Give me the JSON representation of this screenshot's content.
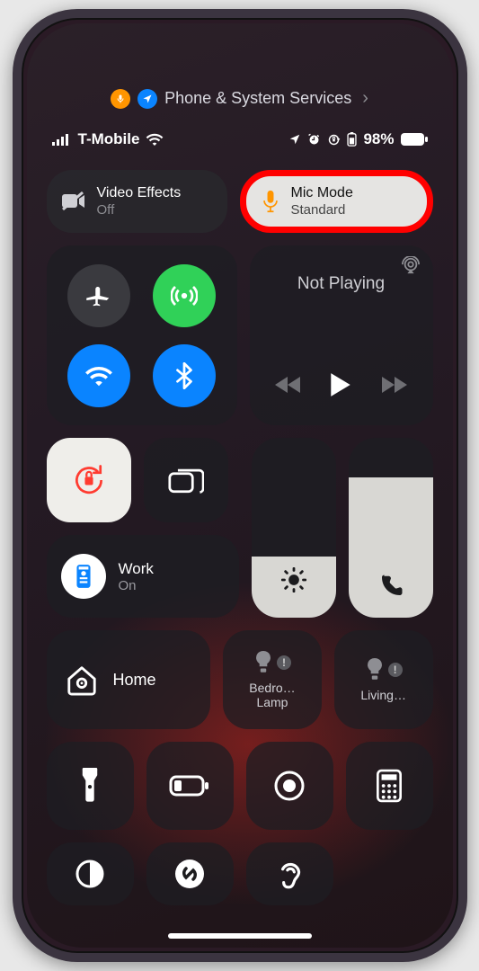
{
  "privacy_banner": {
    "label": "Phone & System Services"
  },
  "status_bar": {
    "carrier": "T-Mobile",
    "battery_pct": "98%"
  },
  "mode_pills": {
    "video": {
      "title": "Video Effects",
      "subtitle": "Off"
    },
    "mic": {
      "title": "Mic Mode",
      "subtitle": "Standard"
    }
  },
  "media": {
    "now_playing": "Not Playing"
  },
  "focus": {
    "title": "Work",
    "subtitle": "On"
  },
  "home": {
    "label": "Home",
    "room1": "Bedro…",
    "room1b": "Lamp",
    "room2": "Living…"
  }
}
